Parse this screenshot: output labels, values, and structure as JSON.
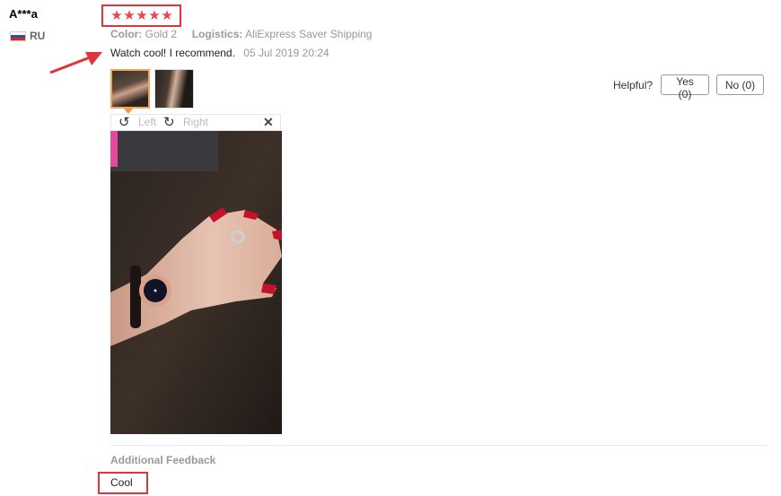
{
  "reviewer": {
    "name": "A***a",
    "country": "RU"
  },
  "rating": {
    "stars": [
      "★",
      "★",
      "★",
      "★",
      "★"
    ]
  },
  "meta": {
    "color_label": "Color:",
    "color_value": "Gold 2",
    "logistics_label": "Logistics:",
    "logistics_value": "AliExpress Saver Shipping"
  },
  "review": {
    "text": "Watch cool! I recommend.",
    "date": "05 Jul 2019 20:24"
  },
  "viewer": {
    "rotate_left_label": "Left",
    "rotate_right_label": "Right",
    "close_glyph": "✕"
  },
  "helpful": {
    "label": "Helpful?",
    "yes_label": "Yes (0)",
    "no_label": "No (0)"
  },
  "additional": {
    "label": "Additional Feedback",
    "text": "Cool"
  },
  "colors": {
    "star": "#f0434a",
    "highlight_box": "#e2333b",
    "thumb_selected": "#f2a45a"
  }
}
